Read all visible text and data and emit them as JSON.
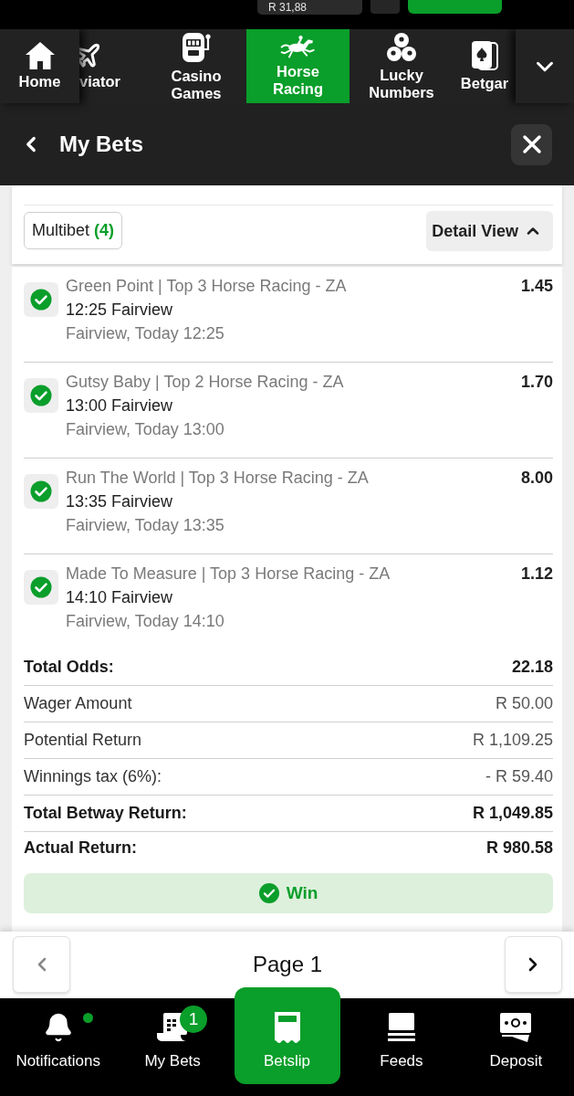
{
  "top_bar": {
    "balance": "R 31,88"
  },
  "category_nav": {
    "items": [
      {
        "label": "Home",
        "kind": "home",
        "selected": false
      },
      {
        "label": "viator",
        "kind": "plane",
        "selected": false
      },
      {
        "label": "Casino Games",
        "kind": "slots",
        "selected": false
      },
      {
        "label": "Horse Racing",
        "kind": "horse",
        "selected": true
      },
      {
        "label": "Lucky Numbers",
        "kind": "balls",
        "selected": false
      },
      {
        "label": "Betgar",
        "kind": "cards",
        "selected": false
      }
    ]
  },
  "header": {
    "title": "My Bets"
  },
  "bet": {
    "type_label": "Multibet",
    "count": "(4)",
    "view_toggle": {
      "label": "Detail View",
      "expanded": true
    },
    "legs": [
      {
        "selection": "Green Point | Top 3 Horse Racing - ZA",
        "event": "12:25 Fairview",
        "details": "Fairview, Today 12:25",
        "odds": "1.45",
        "won": true
      },
      {
        "selection": "Gutsy Baby | Top 2 Horse Racing - ZA",
        "event": "13:00 Fairview",
        "details": "Fairview, Today 13:00",
        "odds": "1.70",
        "won": true
      },
      {
        "selection": "Run The World | Top 3 Horse Racing - ZA",
        "event": "13:35 Fairview",
        "details": "Fairview, Today 13:35",
        "odds": "8.00",
        "won": true
      },
      {
        "selection": "Made To Measure | Top 3 Horse Racing - ZA",
        "event": "14:10 Fairview",
        "details": "Fairview, Today 14:10",
        "odds": "1.12",
        "won": true
      }
    ],
    "summary": [
      {
        "label": "Total Odds:",
        "value": "22.18",
        "bold": true
      },
      {
        "label": "Wager Amount",
        "value": "R 50.00",
        "bold": false
      },
      {
        "label": "Potential Return",
        "value": "R 1,109.25",
        "bold": false
      },
      {
        "label": "Winnings tax (6%):",
        "value": "- R 59.40",
        "bold": false
      },
      {
        "label": "Total Betway Return:",
        "value": "R 1,049.85",
        "bold": true
      },
      {
        "label": "Actual Return:",
        "value": "R 980.58",
        "bold": true
      }
    ],
    "result": {
      "label": "Win",
      "kind": "win"
    }
  },
  "pagination": {
    "label": "Page 1",
    "prev": {
      "disabled": true
    },
    "next": {
      "disabled": false
    }
  },
  "bottom_nav": {
    "items": [
      {
        "label": "Notifications",
        "kind": "bell",
        "dot": true,
        "selected": false
      },
      {
        "label": "My Bets",
        "kind": "receipt",
        "badge": "1",
        "selected": false
      },
      {
        "label": "Betslip",
        "kind": "slip",
        "selected": true
      },
      {
        "label": "Feeds",
        "kind": "feeds",
        "selected": false
      },
      {
        "label": "Deposit",
        "kind": "cash",
        "selected": false
      }
    ]
  }
}
